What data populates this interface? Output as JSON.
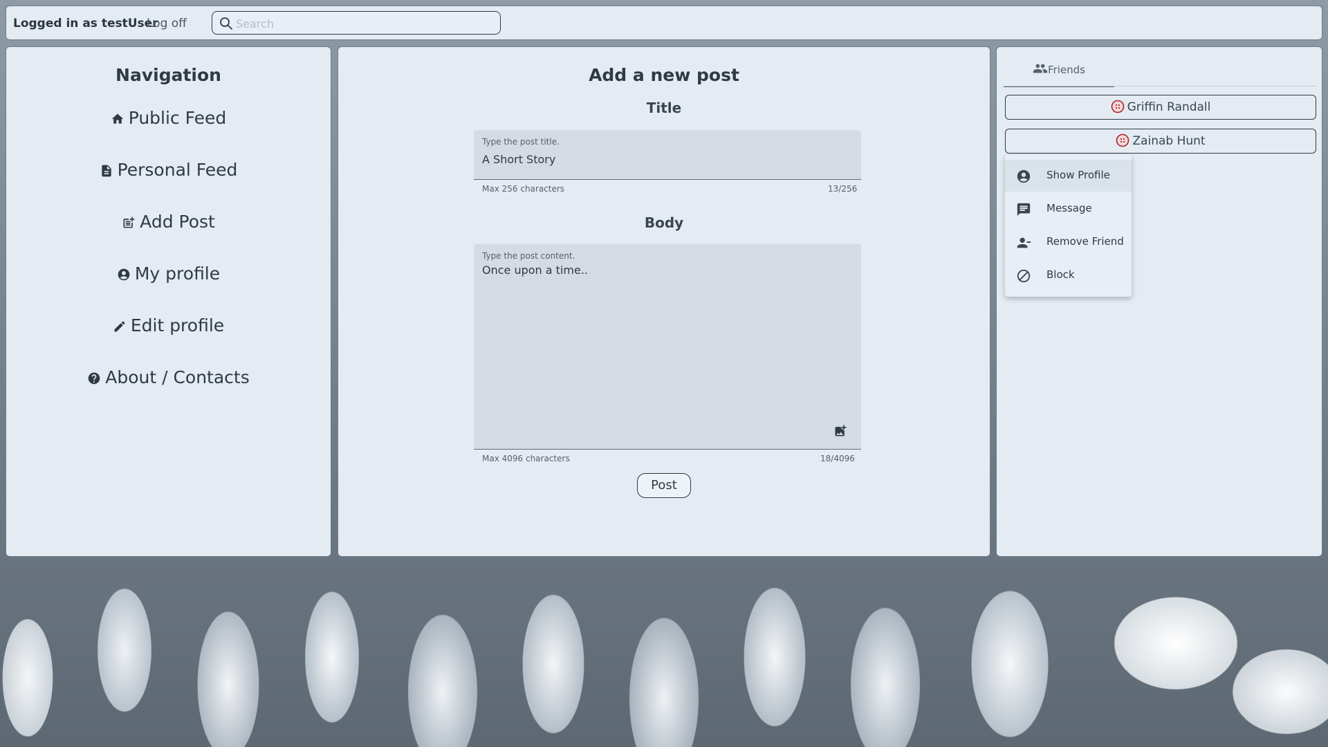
{
  "topbar": {
    "login_text": "Logged in as testUser",
    "logoff_label": "Log off",
    "search_placeholder": "Search",
    "search_value": ""
  },
  "nav": {
    "title": "Navigation",
    "items": [
      {
        "label": "Public Feed",
        "icon": "home-icon"
      },
      {
        "label": "Personal Feed",
        "icon": "document-icon"
      },
      {
        "label": "Add Post",
        "icon": "post-add-icon"
      },
      {
        "label": "My profile",
        "icon": "account-circle-icon"
      },
      {
        "label": "Edit profile",
        "icon": "pencil-icon"
      },
      {
        "label": "About / Contacts",
        "icon": "help-icon"
      }
    ]
  },
  "post_form": {
    "heading": "Add a new post",
    "title_section": "Title",
    "title_field": {
      "label": "Type the post title.",
      "value": "A Short Story",
      "helper": "Max 256 characters",
      "counter": "13/256"
    },
    "body_section": "Body",
    "body_field": {
      "label": "Type the post content.",
      "value": "Once upon a time..",
      "helper": "Max 4096 characters",
      "counter": "18/4096"
    },
    "submit_label": "Post"
  },
  "friends": {
    "tab_label": "Friends",
    "list": [
      {
        "name": "Griffin Randall"
      },
      {
        "name": "Zainab Hunt"
      }
    ],
    "context_menu": [
      {
        "label": "Show Profile",
        "icon": "account-circle-icon"
      },
      {
        "label": "Message",
        "icon": "message-icon"
      },
      {
        "label": "Remove Friend",
        "icon": "remove-person-icon"
      },
      {
        "label": "Block",
        "icon": "block-icon"
      }
    ]
  },
  "colors": {
    "panel_bg": "#e4ebf3",
    "text": "#2f3a45",
    "avatar_ring": "#b0222a"
  }
}
